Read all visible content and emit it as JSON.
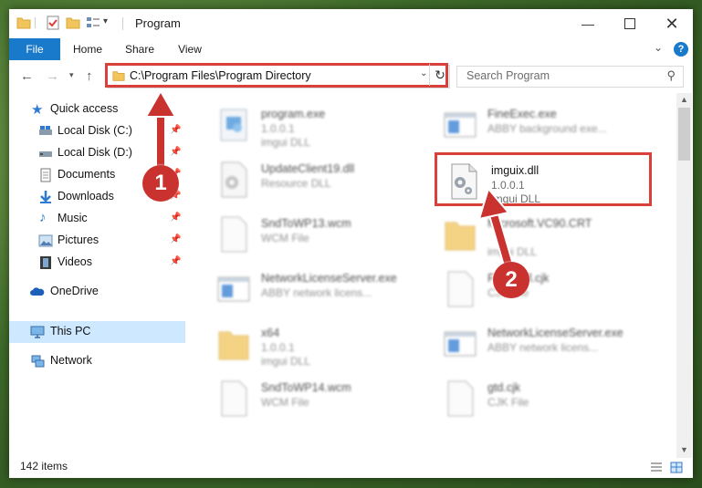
{
  "title": "Program",
  "ribbon": {
    "tabs": [
      {
        "label": "File"
      },
      {
        "label": "Home"
      },
      {
        "label": "Share"
      },
      {
        "label": "View"
      }
    ]
  },
  "address": {
    "path": "C:\\Program Files\\Program Directory",
    "search_placeholder": "Search Program"
  },
  "nav": {
    "items": [
      {
        "label": "Quick access",
        "icon": "star-icon"
      },
      {
        "label": "Local Disk (C:)",
        "icon": "drive-icon"
      },
      {
        "label": "Local Disk (D:)",
        "icon": "drive-icon"
      },
      {
        "label": "Documents",
        "icon": "documents-icon"
      },
      {
        "label": "Downloads",
        "icon": "download-icon"
      },
      {
        "label": "Music",
        "icon": "music-icon"
      },
      {
        "label": "Pictures",
        "icon": "pictures-icon"
      },
      {
        "label": "Videos",
        "icon": "videos-icon"
      },
      {
        "label": "OneDrive",
        "icon": "cloud-icon"
      },
      {
        "label": "This PC",
        "icon": "computer-icon"
      },
      {
        "label": "Network",
        "icon": "network-icon"
      }
    ]
  },
  "files": [
    {
      "name": "program.exe",
      "line2": "1.0.0.1",
      "line3": "imgui DLL",
      "icon": "exe-icon"
    },
    {
      "name": "FineExec.exe",
      "line2": "ABBY background exe...",
      "line3": "",
      "icon": "app-window-icon"
    },
    {
      "name": "UpdateClient19.dll",
      "line2": "Resource DLL",
      "line3": "",
      "icon": "dll-icon"
    },
    {
      "name": "imguix.dll",
      "line2": "1.0.0.1",
      "line3": "imgui DLL",
      "icon": "dll-gear-icon"
    },
    {
      "name": "SndToWP13.wcm",
      "line2": "WCM File",
      "line3": "",
      "icon": "file-icon"
    },
    {
      "name": "Microsoft.VC90.CRT",
      "line2": "",
      "line3": "imgui DLL",
      "icon": "folder-icon"
    },
    {
      "name": "NetworkLicenseServer.exe",
      "line2": "ABBY network licens...",
      "line3": "",
      "icon": "app-window-icon"
    },
    {
      "name": "FaxShell.cjk",
      "line2": "CJK File",
      "line3": "",
      "icon": "file-icon"
    },
    {
      "name": "x64",
      "line2": "1.0.0.1",
      "line3": "imgui DLL",
      "icon": "folder-icon"
    },
    {
      "name": "NetworkLicenseServer.exe",
      "line2": "ABBY network licens...",
      "line3": "",
      "icon": "app-window-icon"
    },
    {
      "name": "SndToWP14.wcm",
      "line2": "WCM File",
      "line3": "",
      "icon": "file-icon"
    },
    {
      "name": "gtd.cjk",
      "line2": "CJK File",
      "line3": "",
      "icon": "file-icon"
    }
  ],
  "status": {
    "items_count": "142 items"
  },
  "callouts": [
    "1",
    "2"
  ],
  "colors": {
    "accent": "#1979ca",
    "highlight": "#d9403c",
    "selection": "#cde8ff"
  }
}
